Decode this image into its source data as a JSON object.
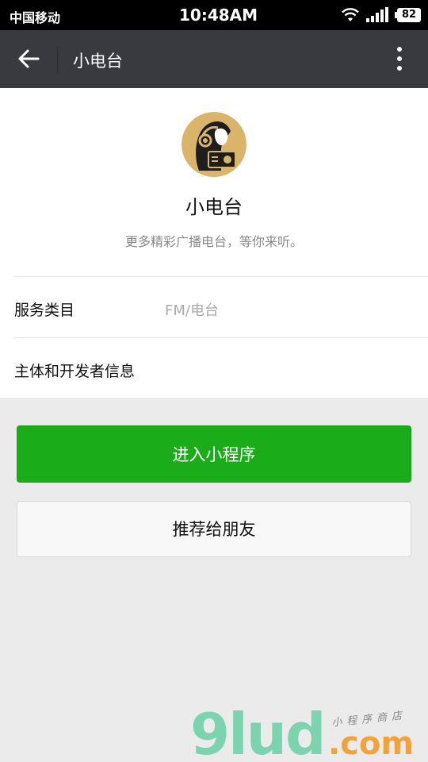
{
  "status_bar": {
    "carrier": "中国移动",
    "time": "10:48AM",
    "battery": "82"
  },
  "nav": {
    "title": "小电台"
  },
  "profile": {
    "name": "小电台",
    "description": "更多精彩广播电台，等你来听。",
    "service_category_label": "服务类目",
    "service_category_value": "FM/电台",
    "developer_info_label": "主体和开发者信息"
  },
  "actions": {
    "enter_label": "进入小程序",
    "share_label": "推荐给朋友"
  },
  "watermark": {
    "main": "9lud",
    "suffix": ".com",
    "tagline": "小程序商店"
  },
  "colors": {
    "nav_bg": "#393a3f",
    "primary_green": "#1aad19",
    "avatar_bg": "#d9b46a"
  }
}
